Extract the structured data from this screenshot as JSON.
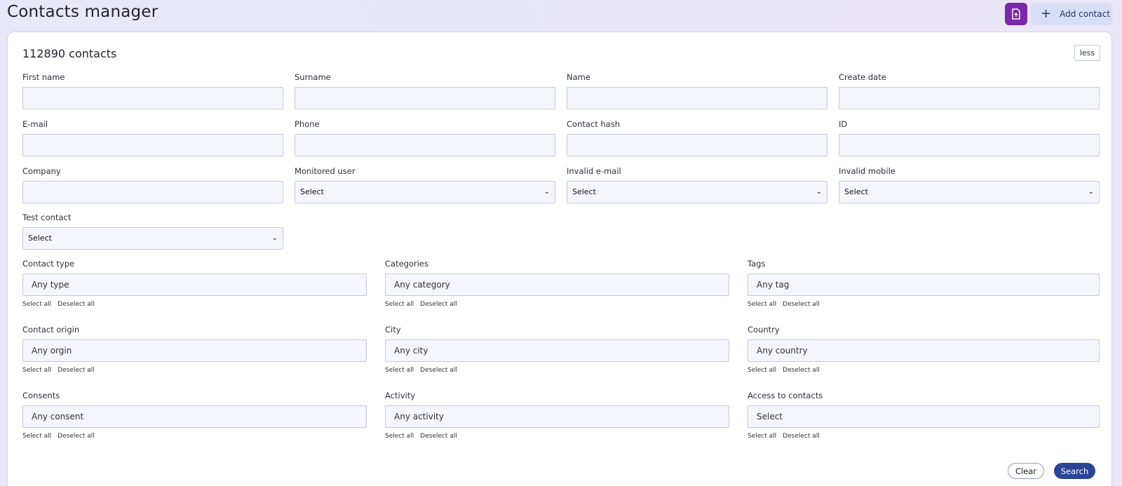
{
  "header": {
    "title": "Contacts manager",
    "export_icon": "export-document-icon",
    "add_icon": "plus-icon",
    "add_label": "Add contact",
    "brand_color": "#7a27a8",
    "add_bg": "#d9def7"
  },
  "filters": {
    "count_text": "112890 contacts",
    "toggle_label": "less",
    "text_fields": {
      "first_name": {
        "label": "First name",
        "value": ""
      },
      "surname": {
        "label": "Surname",
        "value": ""
      },
      "name": {
        "label": "Name",
        "value": ""
      },
      "create_date": {
        "label": "Create date",
        "value": ""
      },
      "email": {
        "label": "E-mail",
        "value": ""
      },
      "phone": {
        "label": "Phone",
        "value": ""
      },
      "contact_hash": {
        "label": "Contact hash",
        "value": ""
      },
      "id": {
        "label": "ID",
        "value": ""
      },
      "company": {
        "label": "Company",
        "value": ""
      }
    },
    "selects": {
      "monitored_user": {
        "label": "Monitored user",
        "value": "Select"
      },
      "invalid_email": {
        "label": "Invalid e-mail",
        "value": "Select"
      },
      "invalid_mobile": {
        "label": "Invalid mobile",
        "value": "Select"
      },
      "test_contact": {
        "label": "Test contact",
        "value": "Select"
      }
    },
    "multi": {
      "contact_type": {
        "label": "Contact type",
        "value": "Any type"
      },
      "categories": {
        "label": "Categories",
        "value": "Any category"
      },
      "tags": {
        "label": "Tags",
        "value": "Any tag"
      },
      "contact_origin": {
        "label": "Contact origin",
        "value": "Any orgin"
      },
      "city": {
        "label": "City",
        "value": "Any city"
      },
      "country": {
        "label": "Country",
        "value": "Any country"
      },
      "consents": {
        "label": "Consents",
        "value": "Any consent"
      },
      "activity": {
        "label": "Activity",
        "value": "Any activity"
      },
      "access_to_contacts": {
        "label": "Access to contacts",
        "value": "Select"
      }
    },
    "select_all_label": "Select all",
    "deselect_all_label": "Deselect all",
    "clear_label": "Clear",
    "search_label": "Search",
    "search_color": "#2a4395"
  }
}
